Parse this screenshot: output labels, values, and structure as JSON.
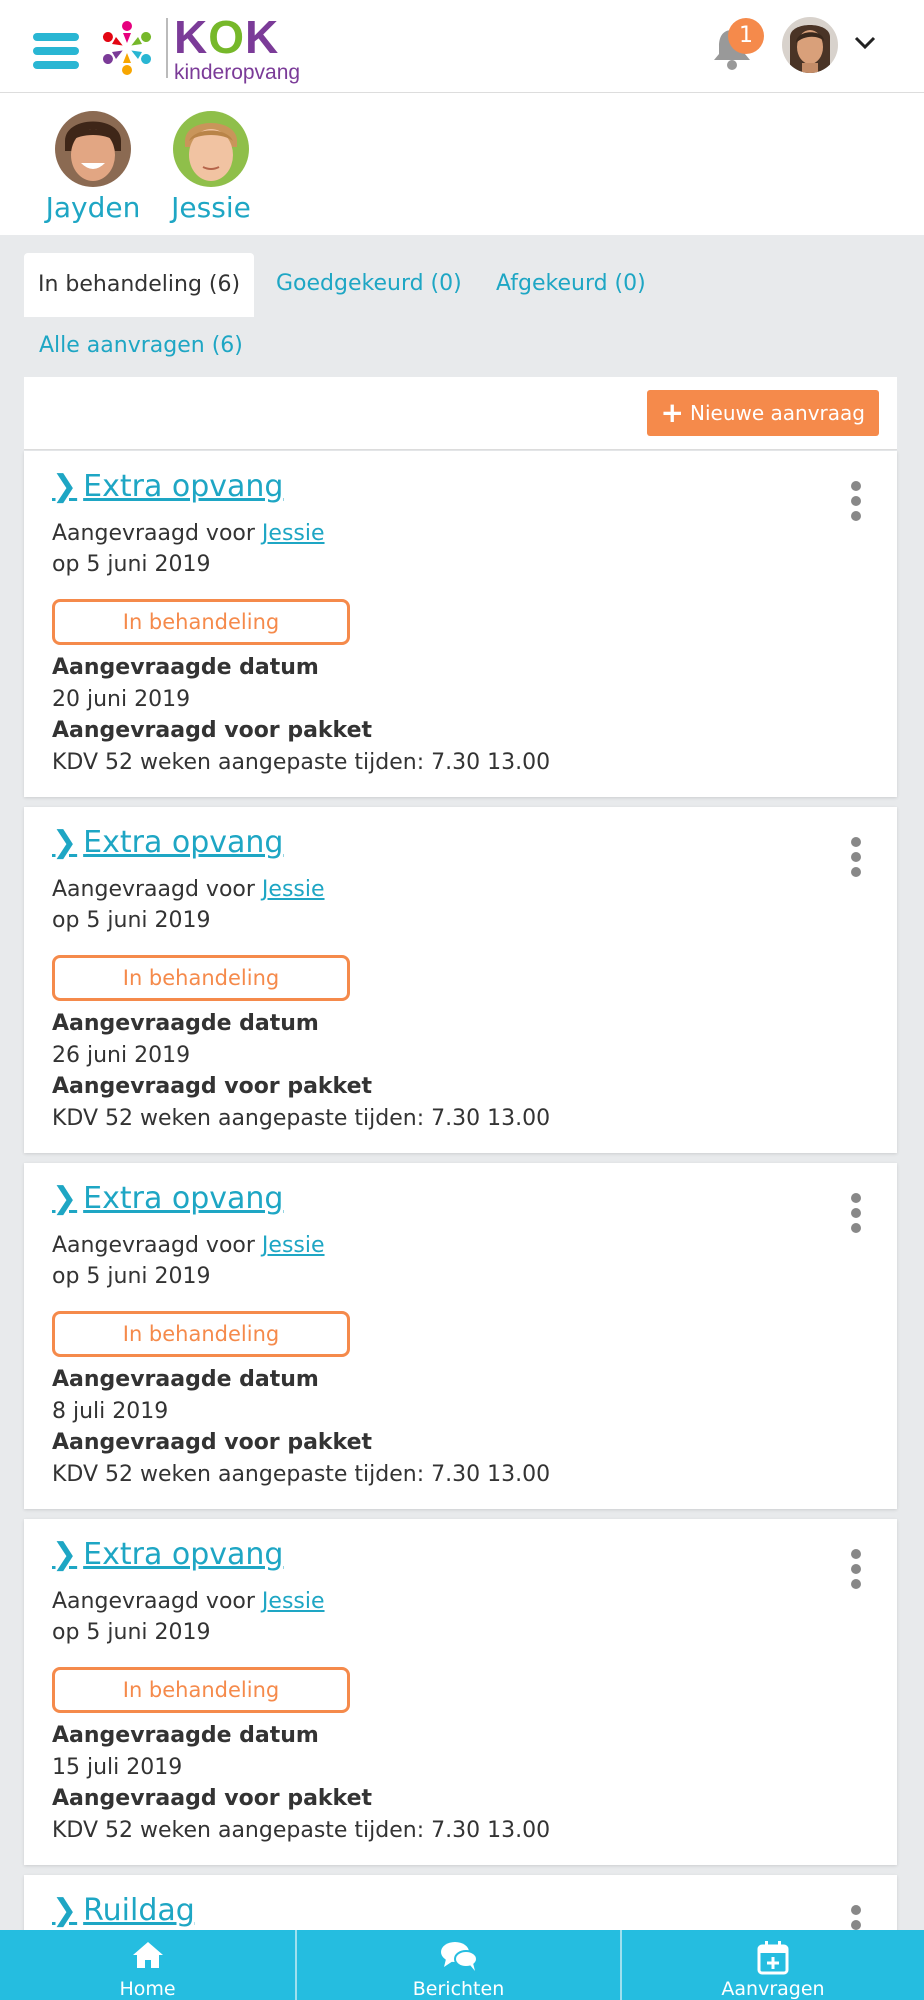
{
  "header": {
    "logo_title": "KOK",
    "logo_subtitle": "kinderopvang",
    "notification_count": "1"
  },
  "children": [
    {
      "name": "Jayden"
    },
    {
      "name": "Jessie"
    }
  ],
  "tabs": [
    {
      "label": "In behandeling (6)"
    },
    {
      "label": "Goedgekeurd (0)"
    },
    {
      "label": "Afgekeurd (0)"
    },
    {
      "label": "Alle aanvragen (6)"
    }
  ],
  "toolbar": {
    "new_request_label": "Nieuwe aanvraag"
  },
  "requests": [
    {
      "title": "Extra opvang",
      "requested_for_prefix": "Aangevraagd voor",
      "child": "Jessie",
      "requested_on": "op 5 juni 2019",
      "status": "In behandeling",
      "date_label": "Aangevraagde datum",
      "date": "20 juni 2019",
      "package_label": "Aangevraagd voor pakket",
      "package": "KDV 52 weken aangepaste tijden: 7.30 13.00"
    },
    {
      "title": "Extra opvang",
      "requested_for_prefix": "Aangevraagd voor",
      "child": "Jessie",
      "requested_on": "op 5 juni 2019",
      "status": "In behandeling",
      "date_label": "Aangevraagde datum",
      "date": "26 juni 2019",
      "package_label": "Aangevraagd voor pakket",
      "package": "KDV 52 weken aangepaste tijden: 7.30 13.00"
    },
    {
      "title": "Extra opvang",
      "requested_for_prefix": "Aangevraagd voor",
      "child": "Jessie",
      "requested_on": "op 5 juni 2019",
      "status": "In behandeling",
      "date_label": "Aangevraagde datum",
      "date": "8 juli 2019",
      "package_label": "Aangevraagd voor pakket",
      "package": "KDV 52 weken aangepaste tijden: 7.30 13.00"
    },
    {
      "title": "Extra opvang",
      "requested_for_prefix": "Aangevraagd voor",
      "child": "Jessie",
      "requested_on": "op 5 juni 2019",
      "status": "In behandeling",
      "date_label": "Aangevraagde datum",
      "date": "15 juli 2019",
      "package_label": "Aangevraagd voor pakket",
      "package": "KDV 52 weken aangepaste tijden: 7.30 13.00"
    },
    {
      "title": "Ruildag"
    }
  ],
  "bottom_nav": [
    {
      "label": "Home",
      "icon": "home-icon"
    },
    {
      "label": "Berichten",
      "icon": "chat-icon"
    },
    {
      "label": "Aanvragen",
      "icon": "calendar-plus-icon"
    }
  ],
  "colors": {
    "accent": "#1ea6c4",
    "orange": "#f58a4b",
    "nav": "#25bde0",
    "purple": "#7b3b98",
    "green": "#76b82a"
  }
}
